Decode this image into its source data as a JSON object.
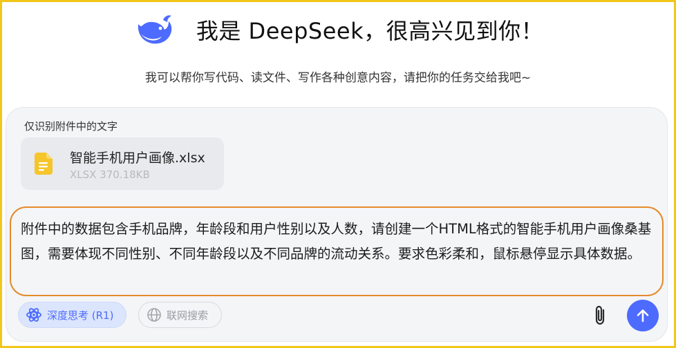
{
  "header": {
    "logo_icon": "deepseek-whale-icon",
    "brand_color": "#4d6bfe",
    "title": "我是 DeepSeek，很高兴见到你！",
    "subtitle": "我可以帮你写代码、读文件、写作各种创意内容，请把你的任务交给我吧~"
  },
  "composer": {
    "attachment_hint": "仅识别附件中的文字",
    "attachment": {
      "icon": "document-file-icon",
      "icon_color": "#f5c52b",
      "name": "智能手机用户画像.xlsx",
      "meta": "XLSX 370.18KB"
    },
    "prompt": "附件中的数据包含手机品牌，年龄段和用户性别以及人数，请创建一个HTML格式的智能手机用户画像桑基图，需要体现不同性别、不同年龄段以及不同品牌的流动关系。要求色彩柔和，鼠标悬停显示具体数据。",
    "highlight_color": "#e58a2a",
    "buttons": {
      "deep_think": "深度思考 (R1)",
      "deep_think_icon": "atom-icon",
      "web_search": "联网搜索",
      "web_search_icon": "globe-icon",
      "attach_icon": "paperclip-icon",
      "send_icon": "arrow-up-icon"
    }
  }
}
